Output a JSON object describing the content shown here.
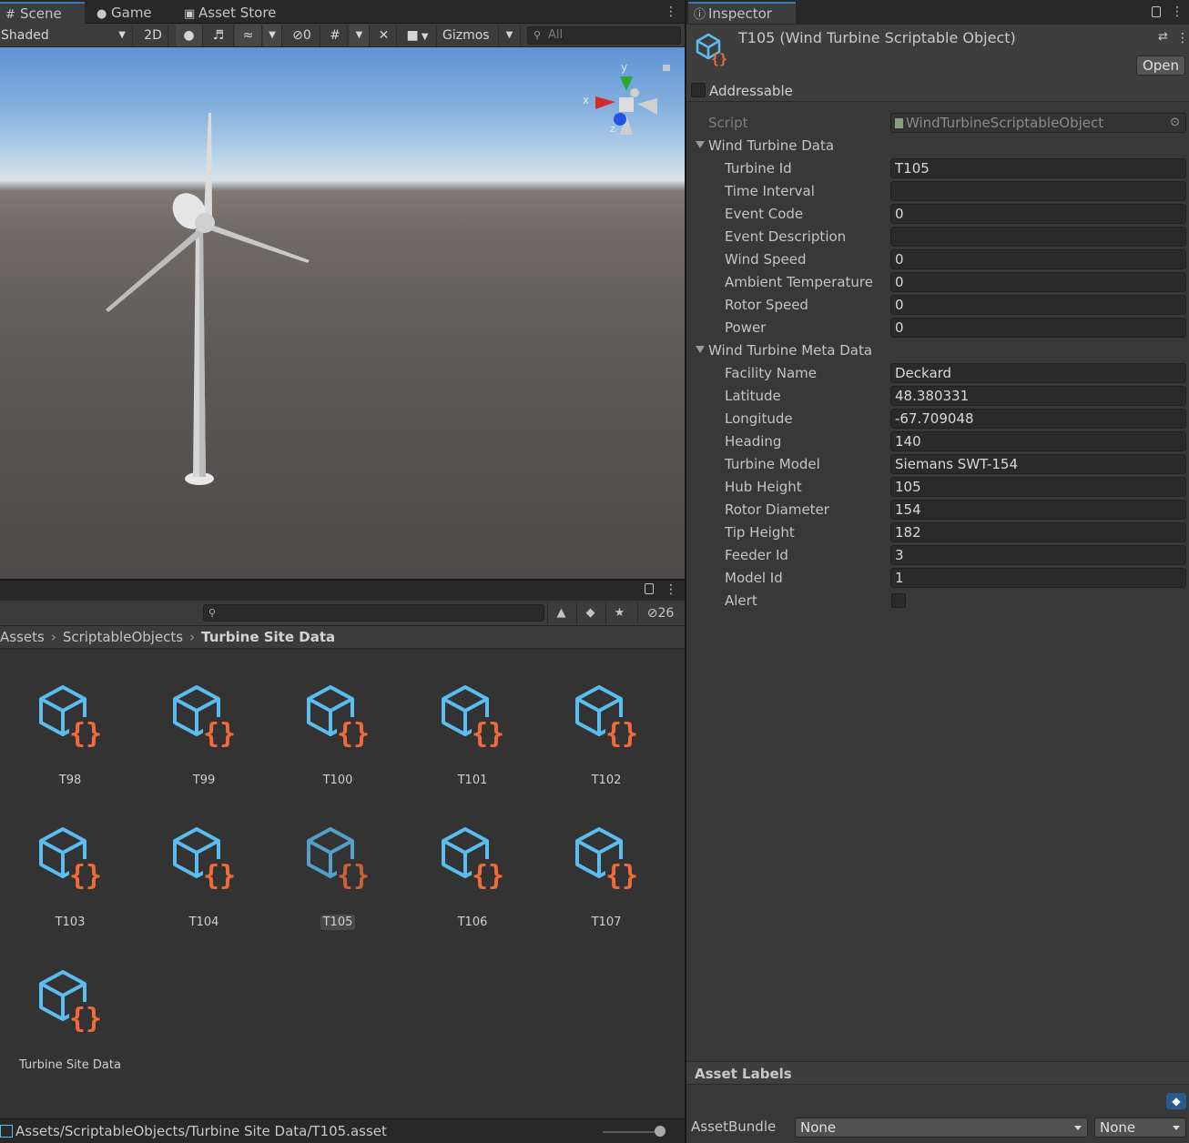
{
  "scene_tabs": [
    {
      "label": "Scene",
      "icon": "grid-icon"
    },
    {
      "label": "Game",
      "icon": "gamepad-icon"
    },
    {
      "label": "Asset Store",
      "icon": "shopping-bag-icon"
    }
  ],
  "scene_toolbar": {
    "shading_mode": "Shaded",
    "mode_2d": "2D",
    "hidden_count": "0",
    "gizmos": "Gizmos",
    "search_placeholder": "All"
  },
  "orientation_gizmo": {
    "x": "x",
    "y": "y",
    "z": "z",
    "projection": "Iso"
  },
  "project": {
    "hidden_count": "26",
    "breadcrumb": [
      "Assets",
      "ScriptableObjects",
      "Turbine Site Data"
    ],
    "assets": [
      {
        "name": "T98"
      },
      {
        "name": "T99"
      },
      {
        "name": "T100"
      },
      {
        "name": "T101"
      },
      {
        "name": "T102"
      },
      {
        "name": "T103"
      },
      {
        "name": "T104"
      },
      {
        "name": "T105",
        "selected": true
      },
      {
        "name": "T106"
      },
      {
        "name": "T107"
      },
      {
        "name": "Turbine Site Data"
      }
    ],
    "status_path": "Assets/ScriptableObjects/Turbine Site Data/T105.asset"
  },
  "inspector": {
    "tab_label": "Inspector",
    "title": "T105 (Wind Turbine Scriptable Object)",
    "open_label": "Open",
    "addressable_label": "Addressable",
    "script_label": "Script",
    "script_value": "WindTurbineScriptableObject",
    "section_data": "Wind Turbine Data",
    "section_meta": "Wind Turbine Meta Data",
    "data_fields": [
      {
        "label": "Turbine Id",
        "value": "T105"
      },
      {
        "label": "Time Interval",
        "value": ""
      },
      {
        "label": "Event Code",
        "value": "0"
      },
      {
        "label": "Event Description",
        "value": ""
      },
      {
        "label": "Wind Speed",
        "value": "0"
      },
      {
        "label": "Ambient Temperature",
        "value": "0"
      },
      {
        "label": "Rotor Speed",
        "value": "0"
      },
      {
        "label": "Power",
        "value": "0"
      }
    ],
    "meta_fields": [
      {
        "label": "Facility Name",
        "value": "Deckard"
      },
      {
        "label": "Latitude",
        "value": "48.380331"
      },
      {
        "label": "Longitude",
        "value": "-67.709048"
      },
      {
        "label": "Heading",
        "value": "140"
      },
      {
        "label": "Turbine Model",
        "value": "Siemans SWT-154"
      },
      {
        "label": "Hub Height",
        "value": "105"
      },
      {
        "label": "Rotor Diameter",
        "value": "154"
      },
      {
        "label": "Tip Height",
        "value": "182"
      },
      {
        "label": "Feeder Id",
        "value": "3"
      },
      {
        "label": "Model Id",
        "value": "1"
      }
    ],
    "alert_label": "Alert",
    "asset_labels_title": "Asset Labels",
    "assetbundle_label": "AssetBundle",
    "assetbundle_value": "None",
    "assetbundle_variant": "None"
  },
  "colors": {
    "accent": "#3a79bb",
    "cube_icon": "#5bbcf0",
    "braces_icon": "#f06a3a"
  }
}
